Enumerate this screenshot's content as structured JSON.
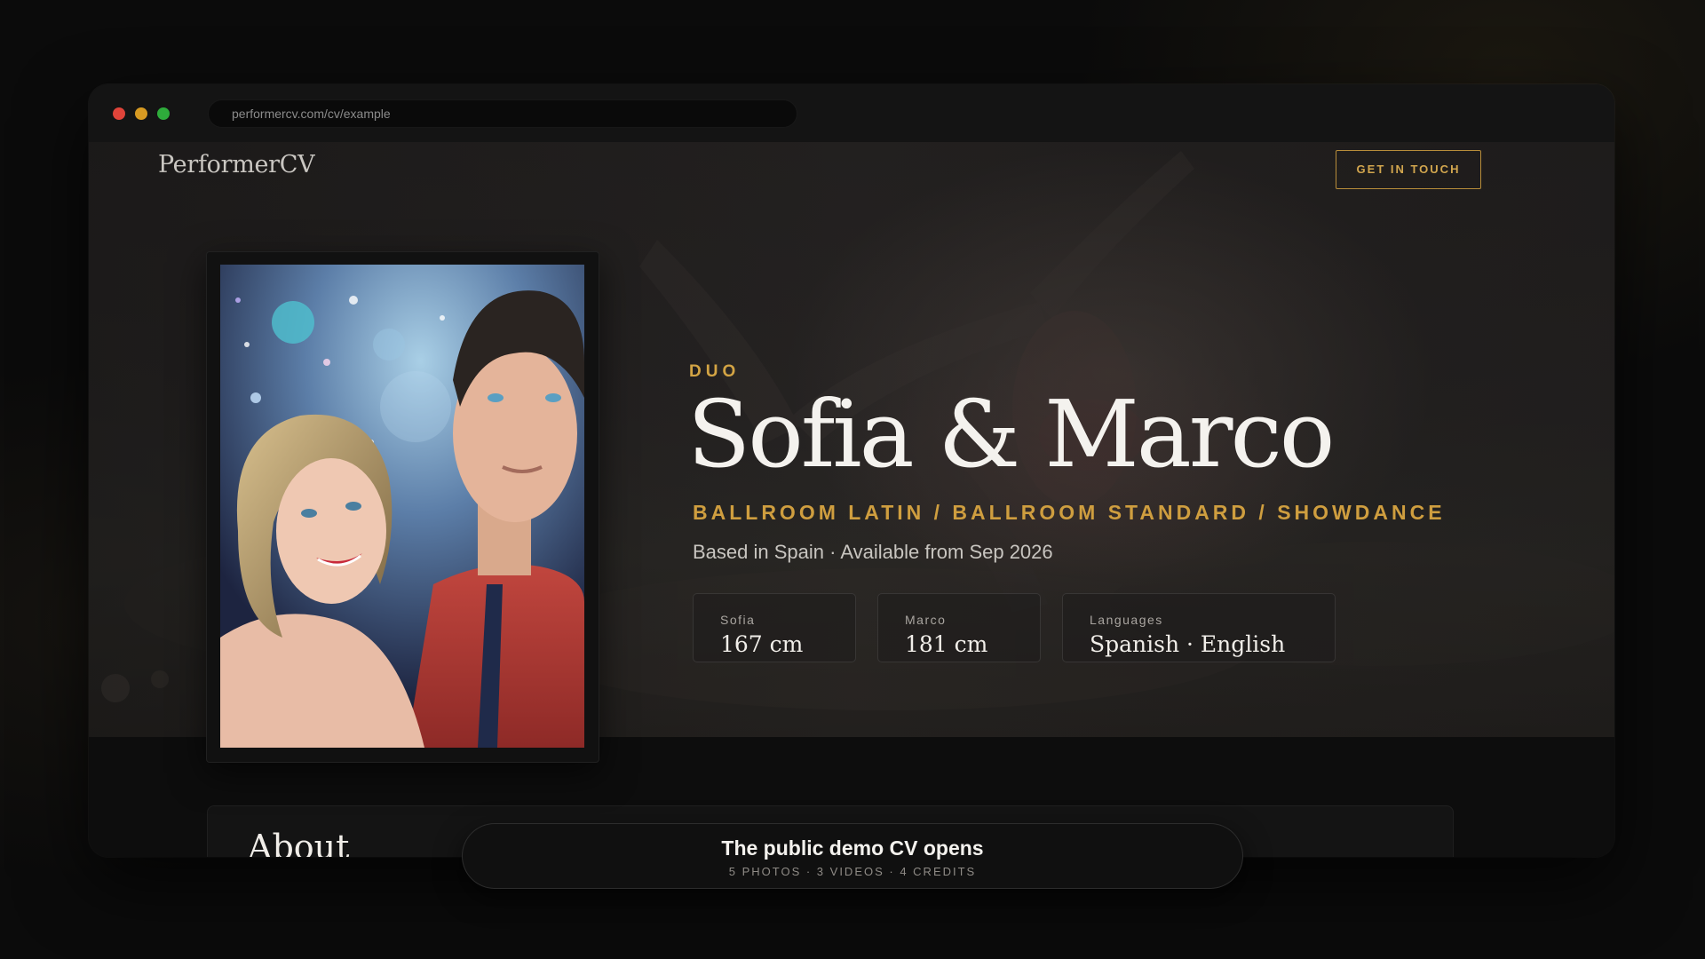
{
  "browser": {
    "url": "performercv.com/cv/example"
  },
  "header": {
    "logo": "PerformerCV",
    "cta_label": "GET IN TOUCH"
  },
  "hero": {
    "kicker": "DUO",
    "title": "Sofia & Marco",
    "styles": "BALLROOM LATIN / BALLROOM STANDARD / SHOWDANCE",
    "meta": "Based in Spain · Available from Sep 2026",
    "stats": [
      {
        "label": "Sofia",
        "value": "167 cm"
      },
      {
        "label": "Marco",
        "value": "181 cm"
      },
      {
        "label": "Languages",
        "value": "Spanish · English"
      }
    ]
  },
  "about": {
    "title": "About"
  },
  "toast": {
    "title": "The public demo CV opens",
    "subtitle": "5 PHOTOS · 3 VIDEOS · 4 CREDITS"
  },
  "colors": {
    "accent_gold": "#cf9e3f",
    "background": "#0b0b0b",
    "traffic_red": "#e0443a",
    "traffic_yellow": "#d79a22",
    "traffic_green": "#2eac3b"
  }
}
